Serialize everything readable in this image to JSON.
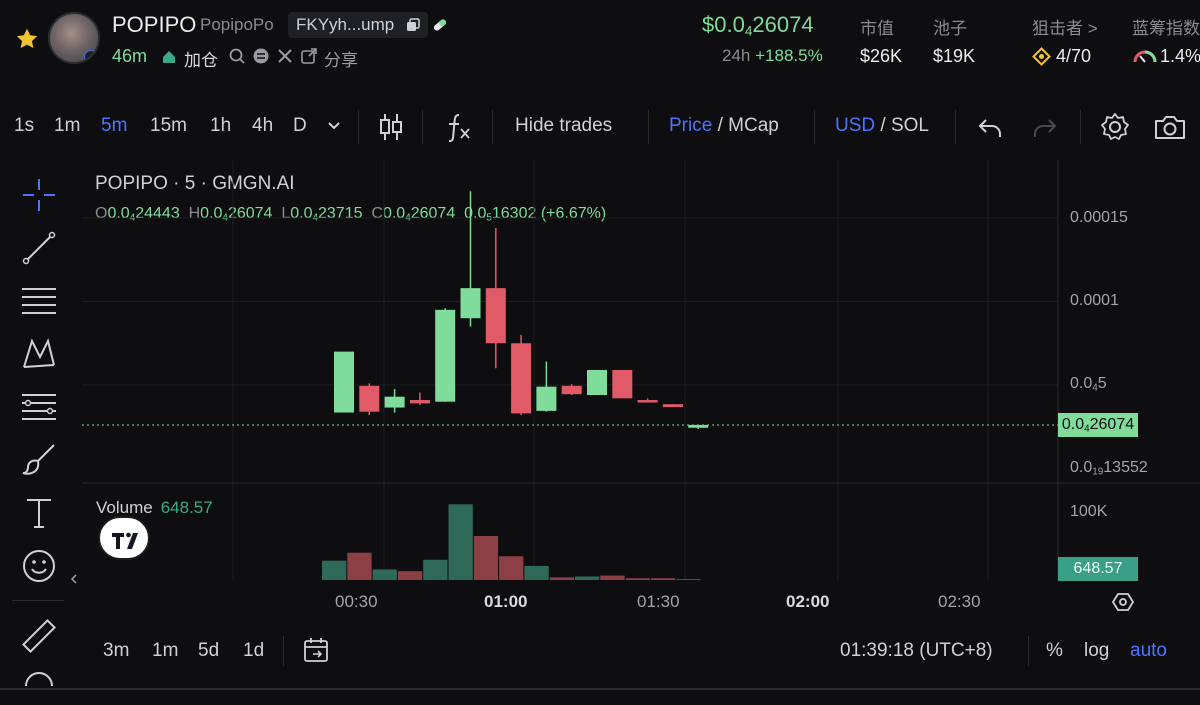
{
  "token": {
    "symbol": "POPIPO",
    "handle": "PopipoPo",
    "address": "FKYyh...ump",
    "age": "46m",
    "add_position": "加仓",
    "share": "分享"
  },
  "stats": {
    "price_main": "$0.0",
    "price_sub": "4",
    "price_tail": "26074",
    "change_label": "24h",
    "change_value": "+188.5%",
    "mcap_label": "市值",
    "mcap_value": "$26K",
    "pool_label": "池子",
    "pool_value": "$19K",
    "snipers_label": "狙击者 >",
    "snipers_value": "4/70",
    "bluechip_label": "蓝筹指数",
    "bluechip_value": "1.4%"
  },
  "toolbar": {
    "intervals": [
      "1s",
      "1m",
      "5m",
      "15m",
      "1h",
      "4h",
      "D"
    ],
    "active_interval": "5m",
    "hide_trades": "Hide trades",
    "price": "Price",
    "slash": "/",
    "mcap": "MCap",
    "usd": "USD",
    "sol": "SOL"
  },
  "chart": {
    "title": "POPIPO · 5 · GMGN.AI",
    "ohlc": {
      "o_label": "O",
      "o_pre": "0.0",
      "o_sub": "4",
      "o_tail": "24443",
      "h_label": "H",
      "h_pre": "0.0",
      "h_sub": "4",
      "h_tail": "26074",
      "l_label": "L",
      "l_pre": "0.0",
      "l_sub": "4",
      "l_tail": "23715",
      "c_label": "C",
      "c_pre": "0.0",
      "c_sub": "4",
      "c_tail": "26074",
      "d_pre": "0.0",
      "d_sub": "5",
      "d_tail": "16302",
      "pct": "(+6.67%)"
    },
    "y_labels": {
      "a": "0.00015",
      "b": "0.0001",
      "c_pre": "0.0",
      "c_sub": "4",
      "c_tail": "5",
      "d_pre": "0.0",
      "d_sub": "19",
      "d_tail": "13552"
    },
    "last_price_pre": "0.0",
    "last_price_sub": "4",
    "last_price_tail": "26074",
    "volume_label": "Volume",
    "volume_value": "648.57",
    "volume_axis": "100K",
    "volume_tag": "648.57",
    "x_labels": [
      "00:30",
      "01:00",
      "01:30",
      "02:00",
      "02:30"
    ],
    "x_bold": [
      "01:00",
      "02:00"
    ]
  },
  "chart_data": {
    "type": "candlestick",
    "title": "POPIPO · 5 · GMGN.AI",
    "x_label_ticks": [
      "00:30",
      "01:00",
      "01:30",
      "02:00",
      "02:30"
    ],
    "y_ticks": [
      0.00015,
      0.0001,
      5e-05
    ],
    "candles": [
      {
        "o": 3.35e-05,
        "h": 3.95e-05,
        "l": 3.4e-05,
        "c": 7e-05,
        "dir": "up"
      },
      {
        "o": 4.95e-05,
        "h": 5.1e-05,
        "l": 3.2e-05,
        "c": 3.4e-05,
        "dir": "down"
      },
      {
        "o": 3.65e-05,
        "h": 4.75e-05,
        "l": 3.35e-05,
        "c": 4.3e-05,
        "dir": "up"
      },
      {
        "o": 4.1e-05,
        "h": 4.55e-05,
        "l": 3.8e-05,
        "c": 3.9e-05,
        "dir": "down"
      },
      {
        "o": 4e-05,
        "h": 9.6e-05,
        "l": 4e-05,
        "c": 9.5e-05,
        "dir": "up"
      },
      {
        "o": 9e-05,
        "h": 0.000166,
        "l": 8.5e-05,
        "c": 0.000108,
        "dir": "up"
      },
      {
        "o": 0.000108,
        "h": 0.000144,
        "l": 6e-05,
        "c": 7.5e-05,
        "dir": "down"
      },
      {
        "o": 7.5e-05,
        "h": 8e-05,
        "l": 3.2e-05,
        "c": 3.3e-05,
        "dir": "down"
      },
      {
        "o": 3.45e-05,
        "h": 6.4e-05,
        "l": 3.4e-05,
        "c": 4.9e-05,
        "dir": "up"
      },
      {
        "o": 4.95e-05,
        "h": 5.05e-05,
        "l": 4.4e-05,
        "c": 4.45e-05,
        "dir": "down"
      },
      {
        "o": 4.4e-05,
        "h": 5.9e-05,
        "l": 4.4e-05,
        "c": 5.9e-05,
        "dir": "up"
      },
      {
        "o": 5.9e-05,
        "h": 5.9e-05,
        "l": 4.2e-05,
        "c": 4.2e-05,
        "dir": "down"
      },
      {
        "o": 4.1e-05,
        "h": 4.2e-05,
        "l": 3.95e-05,
        "c": 3.95e-05,
        "dir": "down"
      },
      {
        "o": 3.85e-05,
        "h": 3.85e-05,
        "l": 3.68e-05,
        "c": 3.68e-05,
        "dir": "down"
      },
      {
        "o": 2.44e-05,
        "h": 2.61e-05,
        "l": 2.37e-05,
        "c": 2.61e-05,
        "dir": "up"
      }
    ],
    "volumes": [
      22,
      31,
      12,
      10,
      23,
      86,
      50,
      27,
      16,
      3,
      4,
      5,
      2,
      2,
      1
    ],
    "volume_unit_max": "100K",
    "last_price": "0.0₄26074",
    "last_volume": "648.57"
  },
  "bottom": {
    "ranges": [
      "3m",
      "1m",
      "5d",
      "1d"
    ],
    "clock": "01:39:18 (UTC+8)",
    "percent": "%",
    "log": "log",
    "auto": "auto"
  },
  "colors": {
    "up": "#7fdc9a",
    "down": "#e05a68",
    "accent": "#4d74ff",
    "volume_up": "#2f6a58",
    "volume_down": "#8d3f46"
  }
}
